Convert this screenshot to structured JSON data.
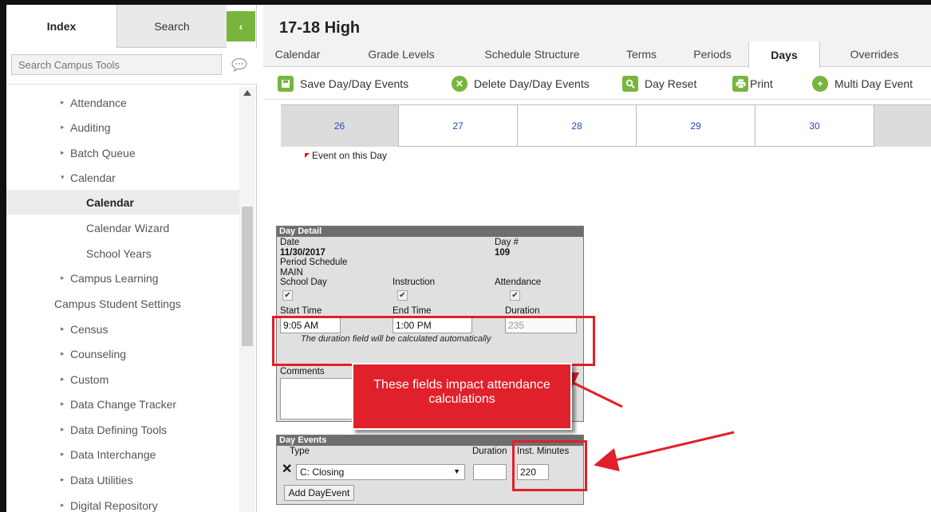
{
  "sidebar": {
    "tabs": {
      "index": "Index",
      "search": "Search"
    },
    "collapse_glyph": "‹",
    "search_placeholder": "Search Campus Tools",
    "nav": [
      {
        "label": "Attendance",
        "caret": "▸"
      },
      {
        "label": "Auditing",
        "caret": "▸"
      },
      {
        "label": "Batch Queue",
        "caret": "▸"
      },
      {
        "label": "Calendar",
        "caret": "▾"
      },
      {
        "label": "Calendar",
        "caret": ""
      },
      {
        "label": "Calendar Wizard",
        "caret": ""
      },
      {
        "label": "School Years",
        "caret": ""
      },
      {
        "label": "Campus Learning",
        "caret": "▸"
      },
      {
        "label": "Campus Student Settings",
        "caret": ""
      },
      {
        "label": "Census",
        "caret": "▸"
      },
      {
        "label": "Counseling",
        "caret": "▸"
      },
      {
        "label": "Custom",
        "caret": "▸"
      },
      {
        "label": "Data Change Tracker",
        "caret": "▸"
      },
      {
        "label": "Data Defining Tools",
        "caret": "▸"
      },
      {
        "label": "Data Interchange",
        "caret": "▸"
      },
      {
        "label": "Data Utilities",
        "caret": "▸"
      },
      {
        "label": "Digital Repository",
        "caret": "▸"
      }
    ]
  },
  "main": {
    "title": "17-18 High",
    "tabs": [
      "Calendar",
      "Grade Levels",
      "Schedule Structure",
      "Terms",
      "Periods",
      "Days",
      "Overrides"
    ],
    "active_tab": "Days",
    "toolbar": {
      "save": "Save Day/Day Events",
      "delete": "Delete Day/Day Events",
      "reset": "Day Reset",
      "print": "Print",
      "multi": "Multi Day Event"
    },
    "calendar_days": [
      "26",
      "27",
      "28",
      "29",
      "30"
    ],
    "event_legend": "Event on this Day"
  },
  "day_detail": {
    "header": "Day Detail",
    "date_label": "Date",
    "date_value": "11/30/2017",
    "day_num_label": "Day #",
    "day_num_value": "109",
    "period_schedule_label": "Period Schedule",
    "period_schedule_value": "MAIN",
    "school_day_label": "School Day",
    "instruction_label": "Instruction",
    "attendance_label": "Attendance",
    "check_glyph": "✔",
    "start_time_label": "Start Time",
    "start_time_value": "9:05 AM",
    "end_time_label": "End Time",
    "end_time_value": "1:00 PM",
    "duration_label": "Duration",
    "duration_value": "235",
    "duration_note": "The duration field will be calculated automatically",
    "comments_label": "Comments"
  },
  "day_events": {
    "header": "Day Events",
    "type_label": "Type",
    "duration_label": "Duration",
    "inst_minutes_label": "Inst. Minutes",
    "delete_glyph": "✕",
    "type_value": "C: Closing",
    "inst_minutes_value": "220",
    "add_button": "Add DayEvent"
  },
  "annotation": {
    "callout_text": "These fields impact attendance calculations",
    "color": "#e0202a"
  },
  "colors": {
    "accent_green": "#77b53c",
    "link_blue": "#2a45c8"
  }
}
